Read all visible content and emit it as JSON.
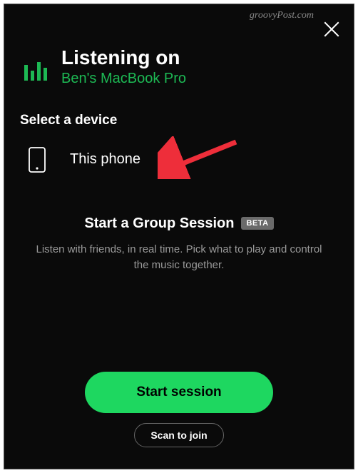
{
  "watermark": "groovyPost.com",
  "header": {
    "title": "Listening on",
    "current_device": "Ben's MacBook Pro"
  },
  "select_label": "Select a device",
  "devices": [
    {
      "label": "This phone"
    }
  ],
  "group_session": {
    "title": "Start a Group Session",
    "badge": "BETA",
    "description": "Listen with friends, in real time. Pick what to play and control the music together."
  },
  "buttons": {
    "start": "Start session",
    "scan": "Scan to join"
  },
  "colors": {
    "accent": "#1db954",
    "button": "#1ed760",
    "background": "#0a0a0a"
  }
}
